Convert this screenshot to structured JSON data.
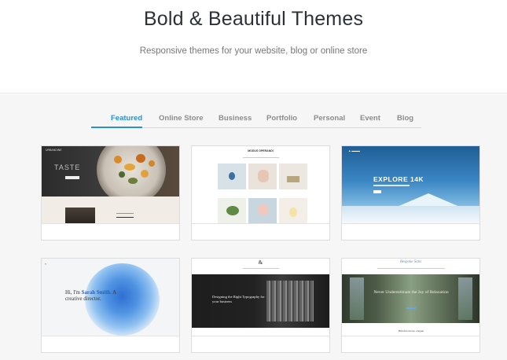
{
  "hero": {
    "title": "Bold & Beautiful Themes",
    "subtitle": "Responsive themes for your website, blog or online store"
  },
  "tabs": [
    {
      "label": "Featured",
      "active": true
    },
    {
      "label": "Online Store",
      "active": false
    },
    {
      "label": "Business",
      "active": false
    },
    {
      "label": "Portfolio",
      "active": false
    },
    {
      "label": "Personal",
      "active": false
    },
    {
      "label": "Event",
      "active": false
    },
    {
      "label": "Blog",
      "active": false
    }
  ],
  "colors": {
    "accent": "#2a8fd3",
    "tab_inactive": "#8c8c8c",
    "gallery_bg": "#f6f6f6"
  },
  "cards": [
    {
      "theme": "restaurant",
      "preview": {
        "brand": "URBANDINE",
        "headline": "TASTE"
      }
    },
    {
      "theme": "minimal-grid",
      "preview": {
        "title": "MODUS OPERANDI"
      }
    },
    {
      "theme": "adventure",
      "preview": {
        "headline": "EXPLORE 14K"
      }
    },
    {
      "theme": "portfolio",
      "preview": {
        "line1": "Hi, I'm ",
        "name": "Sarah Smith.",
        "line2": " A creative director."
      }
    },
    {
      "theme": "agency",
      "preview": {
        "logo": "&",
        "headline": "Designing the Right Typography for your business"
      }
    },
    {
      "theme": "botanical",
      "preview": {
        "logo": "Bespoke Sans",
        "headline": "Never Underestimate the Joy of Relaxation",
        "caption": "Blissful retreat, elegant"
      }
    }
  ]
}
